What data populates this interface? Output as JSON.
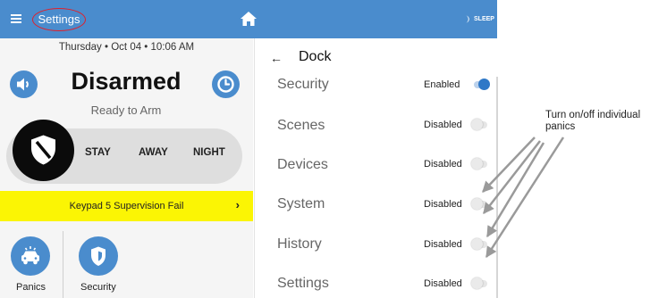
{
  "topbar": {
    "menu_icon": "hamburger-menu-icon",
    "title": "Settings",
    "home_icon": "home-icon",
    "sleep_label": "SLEEP",
    "sleep_icon": "moon-icon",
    "highlight_color": "#e0202a",
    "bar_color": "#4a8ccd"
  },
  "left_panel": {
    "datetime": "Thursday  •  Oct 04  •  10:06 AM",
    "status": "Disarmed",
    "substatus": "Ready to Arm",
    "speaker_icon": "speaker-icon",
    "clock_icon": "clock-icon",
    "shield_icon": "shield-icon",
    "arm_options": [
      "STAY",
      "AWAY",
      "NIGHT"
    ],
    "alert": {
      "text": "Keypad 5 Supervision Fail",
      "chevron": "›",
      "color": "#fbf504"
    },
    "tiles": [
      {
        "label": "Panics",
        "icon": "police-car-icon"
      },
      {
        "label": "Security",
        "icon": "security-shield-icon"
      }
    ]
  },
  "right_panel": {
    "back_arrow": "←",
    "title": "Dock",
    "rows": [
      {
        "label": "Security",
        "status": "Enabled",
        "on": true
      },
      {
        "label": "Scenes",
        "status": "Disabled",
        "on": false
      },
      {
        "label": "Devices",
        "status": "Disabled",
        "on": false
      },
      {
        "label": "System",
        "status": "Disabled",
        "on": false
      },
      {
        "label": "History",
        "status": "Disabled",
        "on": false
      },
      {
        "label": "Settings",
        "status": "Disabled",
        "on": false
      }
    ],
    "toggle_on_color": "#2f78c7"
  },
  "annotation": {
    "text": "Turn on/off individual panics",
    "arrow_color": "#9a9a9a"
  }
}
